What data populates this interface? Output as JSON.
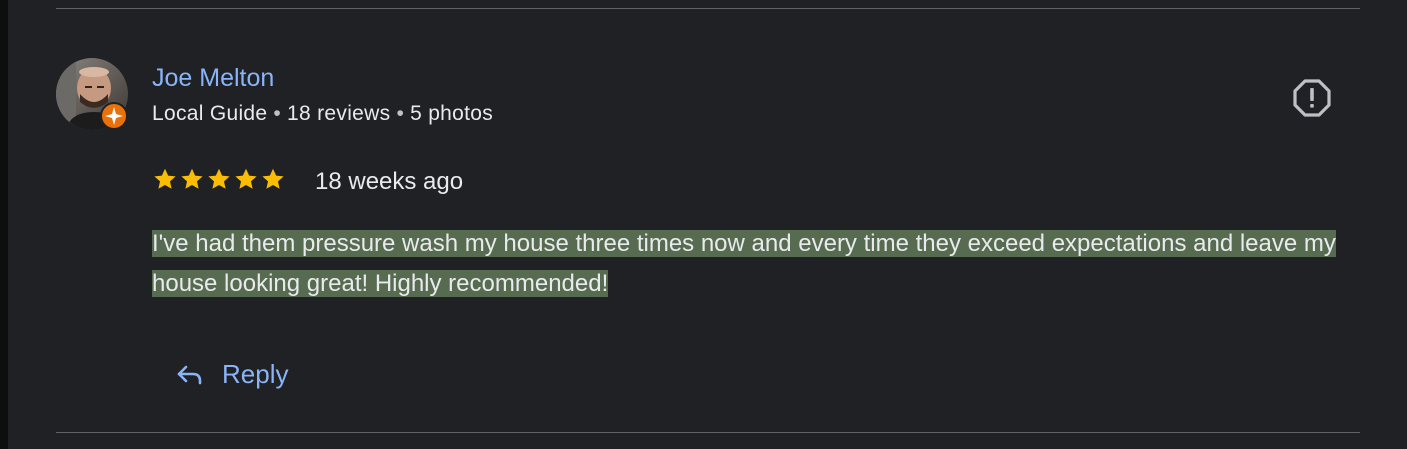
{
  "reviewer": {
    "name": "Joe Melton",
    "badge": "Local Guide",
    "reviews": "18 reviews",
    "photos": "5 photos",
    "separator": "•"
  },
  "rating": {
    "stars": 5,
    "max": 5,
    "time": "18 weeks ago"
  },
  "review": {
    "text": "I've had them pressure wash my house three times now and every time they exceed expectations and leave my house looking great! Highly recommended!"
  },
  "actions": {
    "reply_label": "Reply"
  },
  "icons": {
    "report": "report-flag-icon",
    "reply": "reply-arrow-icon",
    "star": "star-icon",
    "local_guide_badge": "local-guide-badge-icon"
  },
  "colors": {
    "background": "#202124",
    "link": "#8ab4f8",
    "text": "#e8eaed",
    "star": "#fbbc04",
    "highlight": "#566b4f",
    "badge": "#e8710a"
  }
}
